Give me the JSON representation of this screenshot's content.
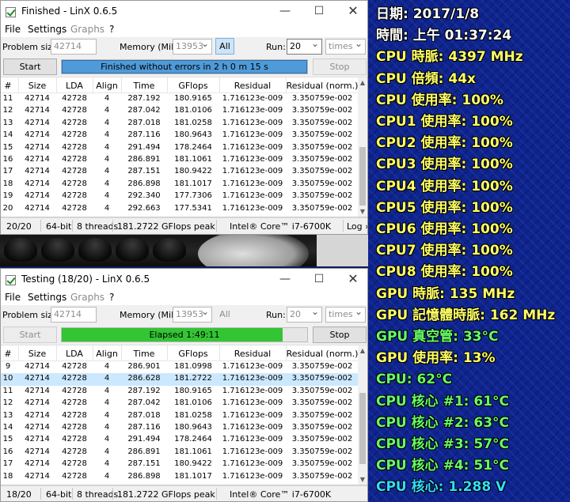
{
  "window1": {
    "title": "Finished - LinX 0.6.5",
    "menu": [
      "File",
      "Settings",
      "Graphs",
      "?"
    ],
    "problem_size_label": "Problem size:",
    "problem_size_value": "42714",
    "memory_label": "Memory (MiB):",
    "memory_value": "13953",
    "all_label": "All",
    "run_label": "Run:",
    "run_value": "20",
    "times_value": "times",
    "start_label": "Start",
    "stop_label": "Stop",
    "progress_text": "Finished without errors in 2 h 0 m 15 s",
    "progress_fraction": 1.0,
    "columns": [
      "#",
      "Size",
      "LDA",
      "Align",
      "Time",
      "GFlops",
      "Residual",
      "Residual (norm.)"
    ],
    "rows": [
      [
        "11",
        "42714",
        "42728",
        "4",
        "287.192",
        "180.9165",
        "1.716123e-009",
        "3.350759e-002"
      ],
      [
        "12",
        "42714",
        "42728",
        "4",
        "287.042",
        "181.0106",
        "1.716123e-009",
        "3.350759e-002"
      ],
      [
        "13",
        "42714",
        "42728",
        "4",
        "287.018",
        "181.0258",
        "1.716123e-009",
        "3.350759e-002"
      ],
      [
        "14",
        "42714",
        "42728",
        "4",
        "287.116",
        "180.9643",
        "1.716123e-009",
        "3.350759e-002"
      ],
      [
        "15",
        "42714",
        "42728",
        "4",
        "291.494",
        "178.2464",
        "1.716123e-009",
        "3.350759e-002"
      ],
      [
        "16",
        "42714",
        "42728",
        "4",
        "286.891",
        "181.1061",
        "1.716123e-009",
        "3.350759e-002"
      ],
      [
        "17",
        "42714",
        "42728",
        "4",
        "287.151",
        "180.9422",
        "1.716123e-009",
        "3.350759e-002"
      ],
      [
        "18",
        "42714",
        "42728",
        "4",
        "286.898",
        "181.1017",
        "1.716123e-009",
        "3.350759e-002"
      ],
      [
        "19",
        "42714",
        "42728",
        "4",
        "292.340",
        "177.7306",
        "1.716123e-009",
        "3.350759e-002"
      ],
      [
        "20",
        "42714",
        "42728",
        "4",
        "292.663",
        "177.5341",
        "1.716123e-009",
        "3.350759e-002"
      ]
    ],
    "status": [
      "20/20",
      "64-bit",
      "8 threads",
      "181.2722 GFlops peak",
      "Intel® Core™ i7-6700K",
      "Log ›"
    ]
  },
  "window2": {
    "title": "Testing (18/20) - LinX 0.6.5",
    "menu": [
      "File",
      "Settings",
      "Graphs",
      "?"
    ],
    "problem_size_label": "Problem size:",
    "problem_size_value": "42714",
    "memory_label": "Memory (MiB):",
    "memory_value": "13953",
    "all_label": "All",
    "run_label": "Run:",
    "run_value": "20",
    "times_value": "times",
    "start_label": "Start",
    "stop_label": "Stop",
    "progress_text": "Elapsed 1:49:11",
    "progress_fraction": 0.9,
    "columns": [
      "#",
      "Size",
      "LDA",
      "Align",
      "Time",
      "GFlops",
      "Residual",
      "Residual (norm.)"
    ],
    "rows": [
      [
        "9",
        "42714",
        "42728",
        "4",
        "286.901",
        "181.0998",
        "1.716123e-009",
        "3.350759e-002"
      ],
      [
        "10",
        "42714",
        "42728",
        "4",
        "286.628",
        "181.2722",
        "1.716123e-009",
        "3.350759e-002"
      ],
      [
        "11",
        "42714",
        "42728",
        "4",
        "287.192",
        "180.9165",
        "1.716123e-009",
        "3.350759e-002"
      ],
      [
        "12",
        "42714",
        "42728",
        "4",
        "287.042",
        "181.0106",
        "1.716123e-009",
        "3.350759e-002"
      ],
      [
        "13",
        "42714",
        "42728",
        "4",
        "287.018",
        "181.0258",
        "1.716123e-009",
        "3.350759e-002"
      ],
      [
        "14",
        "42714",
        "42728",
        "4",
        "287.116",
        "180.9643",
        "1.716123e-009",
        "3.350759e-002"
      ],
      [
        "15",
        "42714",
        "42728",
        "4",
        "291.494",
        "178.2464",
        "1.716123e-009",
        "3.350759e-002"
      ],
      [
        "16",
        "42714",
        "42728",
        "4",
        "286.891",
        "181.1061",
        "1.716123e-009",
        "3.350759e-002"
      ],
      [
        "17",
        "42714",
        "42728",
        "4",
        "287.151",
        "180.9422",
        "1.716123e-009",
        "3.350759e-002"
      ],
      [
        "18",
        "42714",
        "42728",
        "4",
        "286.898",
        "181.1017",
        "1.716123e-009",
        "3.350759e-002"
      ]
    ],
    "selected_row": 1,
    "status": [
      "18/20",
      "64-bit",
      "8 threads",
      "181.2722 GFlops peak",
      "Intel® Core™ i7-6700K"
    ]
  },
  "osd": {
    "lines": [
      {
        "text": "日期: 2017/1/8",
        "color": "#ffffff"
      },
      {
        "text": "時間: 上午 01:37:24",
        "color": "#ffffff"
      },
      {
        "text": "CPU 時脈: 4397 MHz",
        "color": "#ffff66"
      },
      {
        "text": "CPU 倍頻: 44x",
        "color": "#ffff66"
      },
      {
        "text": "CPU 使用率: 100%",
        "color": "#ffff66"
      },
      {
        "text": "CPU1 使用率: 100%",
        "color": "#ffff66"
      },
      {
        "text": "CPU2 使用率: 100%",
        "color": "#ffff66"
      },
      {
        "text": "CPU3 使用率: 100%",
        "color": "#ffff66"
      },
      {
        "text": "CPU4 使用率: 100%",
        "color": "#ffff66"
      },
      {
        "text": "CPU5 使用率: 100%",
        "color": "#ffff66"
      },
      {
        "text": "CPU6 使用率: 100%",
        "color": "#ffff66"
      },
      {
        "text": "CPU7 使用率: 100%",
        "color": "#ffff66"
      },
      {
        "text": "CPU8 使用率: 100%",
        "color": "#ffff66"
      },
      {
        "text": "GPU 時脈: 135 MHz",
        "color": "#ffff66"
      },
      {
        "text": "GPU 記憶體時脈: 162 MHz",
        "color": "#ffff66"
      },
      {
        "text": "GPU 真空管: 33°C",
        "color": "#66ff66"
      },
      {
        "text": "GPU 使用率: 13%",
        "color": "#ffff66"
      },
      {
        "text": "CPU: 62°C",
        "color": "#66ff66"
      },
      {
        "text": "CPU 核心 #1: 61°C",
        "color": "#66ff66"
      },
      {
        "text": "CPU 核心 #2: 63°C",
        "color": "#66ff66"
      },
      {
        "text": "CPU 核心 #3: 57°C",
        "color": "#66ff66"
      },
      {
        "text": "CPU 核心 #4: 51°C",
        "color": "#66ff66"
      },
      {
        "text": "CPU 核心: 1.288 V",
        "color": "#33ddff"
      }
    ]
  },
  "colors": {
    "progress_finished": "#4f9ad8",
    "progress_running": "#33c533",
    "selected_row": "#cce8ff",
    "osd_background": "#0e2490"
  }
}
